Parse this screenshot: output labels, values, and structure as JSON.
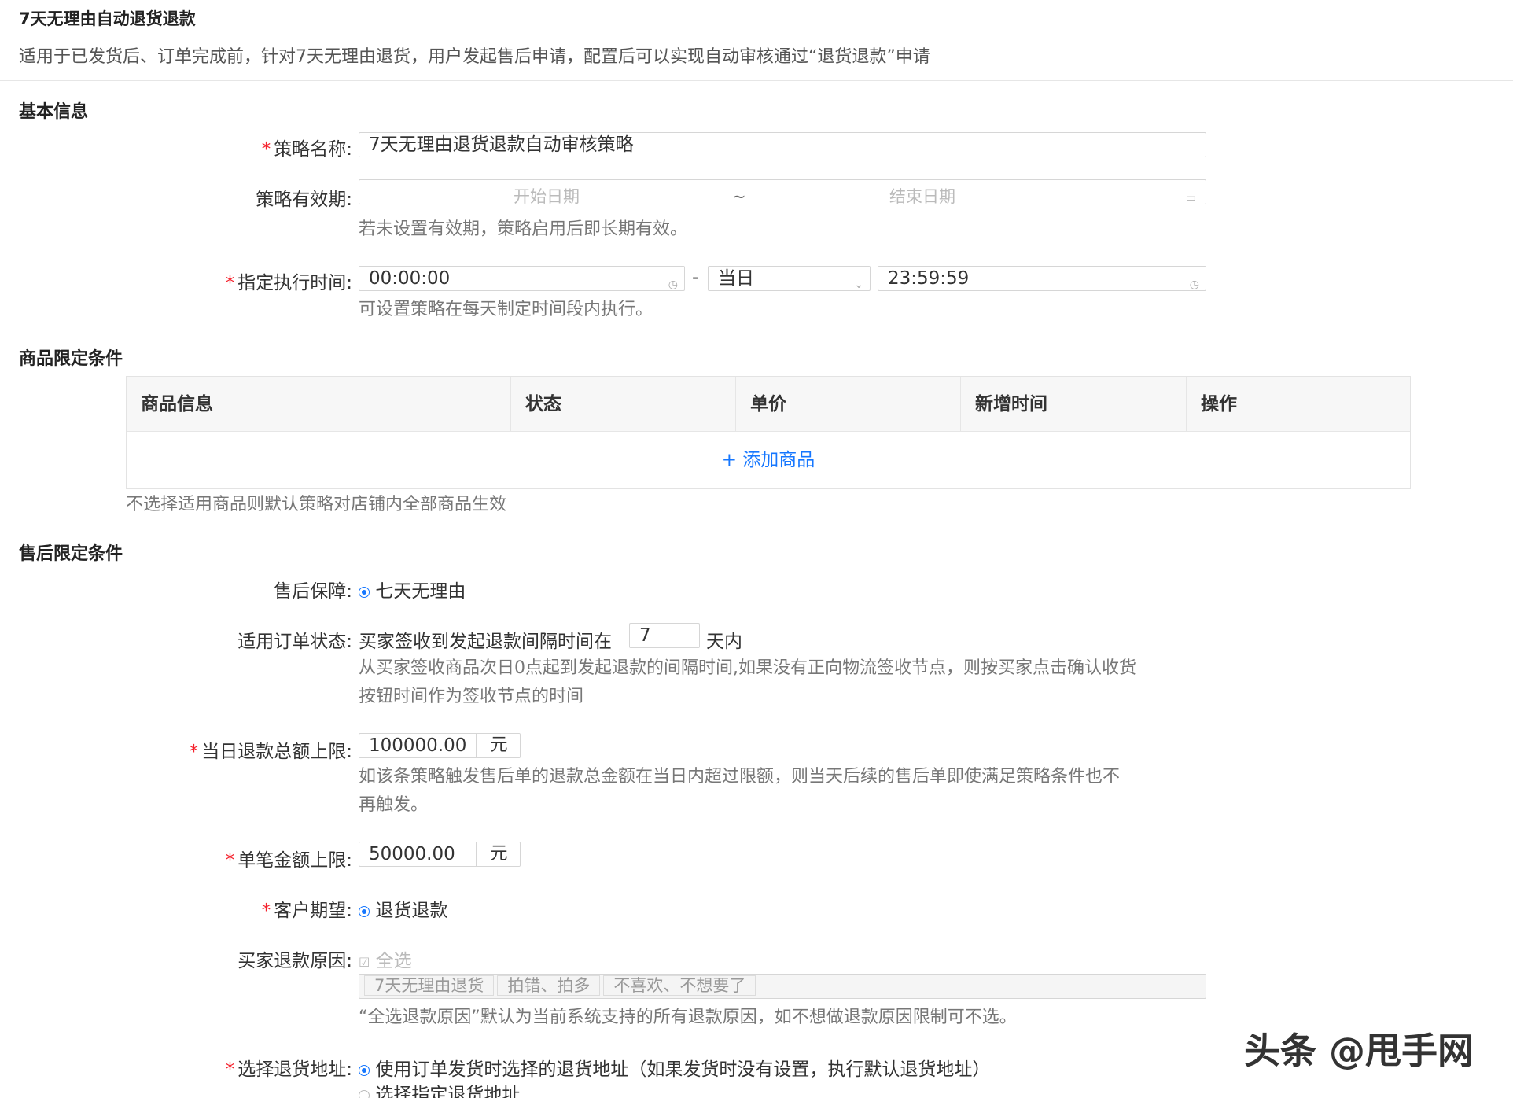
{
  "header": {
    "title": "7天无理由自动退货退款",
    "description": "适用于已发货后、订单完成前，针对7天无理由退货，用户发起售后申请，配置后可以实现自动审核通过“退货退款”申请"
  },
  "basic": {
    "section_title": "基本信息",
    "name_label": "策略名称:",
    "name_value": "7天无理由退货退款自动审核策略",
    "validity_label": "策略有效期:",
    "start_placeholder": "开始日期",
    "range_sep": "~",
    "end_placeholder": "结束日期",
    "validity_help": "若未设置有效期，策略启用后即长期有效。",
    "exec_label": "指定执行时间:",
    "exec_start": "00:00:00",
    "exec_dash": "-",
    "exec_day": "当日",
    "exec_end": "23:59:59",
    "exec_help": "可设置策略在每天制定时间段内执行。"
  },
  "goods": {
    "section_title": "商品限定条件",
    "columns": [
      "商品信息",
      "状态",
      "单价",
      "新增时间",
      "操作"
    ],
    "add_label": "+ 添加商品",
    "help": "不选择适用商品则默认策略对店铺内全部商品生效"
  },
  "aftersale": {
    "section_title": "售后限定条件",
    "guarantee_label": "售后保障:",
    "guarantee_option": "七天无理由",
    "order_status_label": "适用订单状态:",
    "order_status_prefix": "买家签收到发起退款间隔时间在",
    "order_status_days": "7",
    "order_status_suffix": "天内",
    "order_status_help_1": "从买家签收商品次日0点起到发起退款的间隔时间,如果没有正向物流签收节点，则按买家点击确认收货",
    "order_status_help_2": "按钮时间作为签收节点的时间",
    "daily_limit_label": "当日退款总额上限:",
    "daily_limit_value": "100000.00",
    "daily_limit_unit": "元",
    "daily_limit_help_1": "如该条策略触发售后单的退款总金额在当日内超过限额，则当天后续的售后单即使满足策略条件也不",
    "daily_limit_help_2": "再触发。",
    "single_limit_label": "单笔金额上限:",
    "single_limit_value": "50000.00",
    "single_limit_unit": "元",
    "expect_label": "客户期望:",
    "expect_option": "退货退款",
    "reason_label": "买家退款原因:",
    "reason_select_all": "全选",
    "reason_tags": [
      "7天无理由退货",
      "拍错、拍多",
      "不喜欢、不想要了"
    ],
    "reason_help": "“全选退款原因”默认为当前系统支持的所有退款原因，如不想做退款原因限制可不选。",
    "address_label": "选择退货地址:",
    "address_option_1": "使用订单发货时选择的退货地址（如果发货时没有设置，执行默认退货地址）",
    "address_option_2": "选择指定退货地址"
  },
  "watermark": "头条 @甩手网",
  "colors": {
    "accent": "#1677ff",
    "required": "#f5222d"
  },
  "icons": [
    "calendar-icon",
    "clock-icon",
    "chevron-down-icon",
    "checkbox-icon",
    "radio-icon"
  ]
}
